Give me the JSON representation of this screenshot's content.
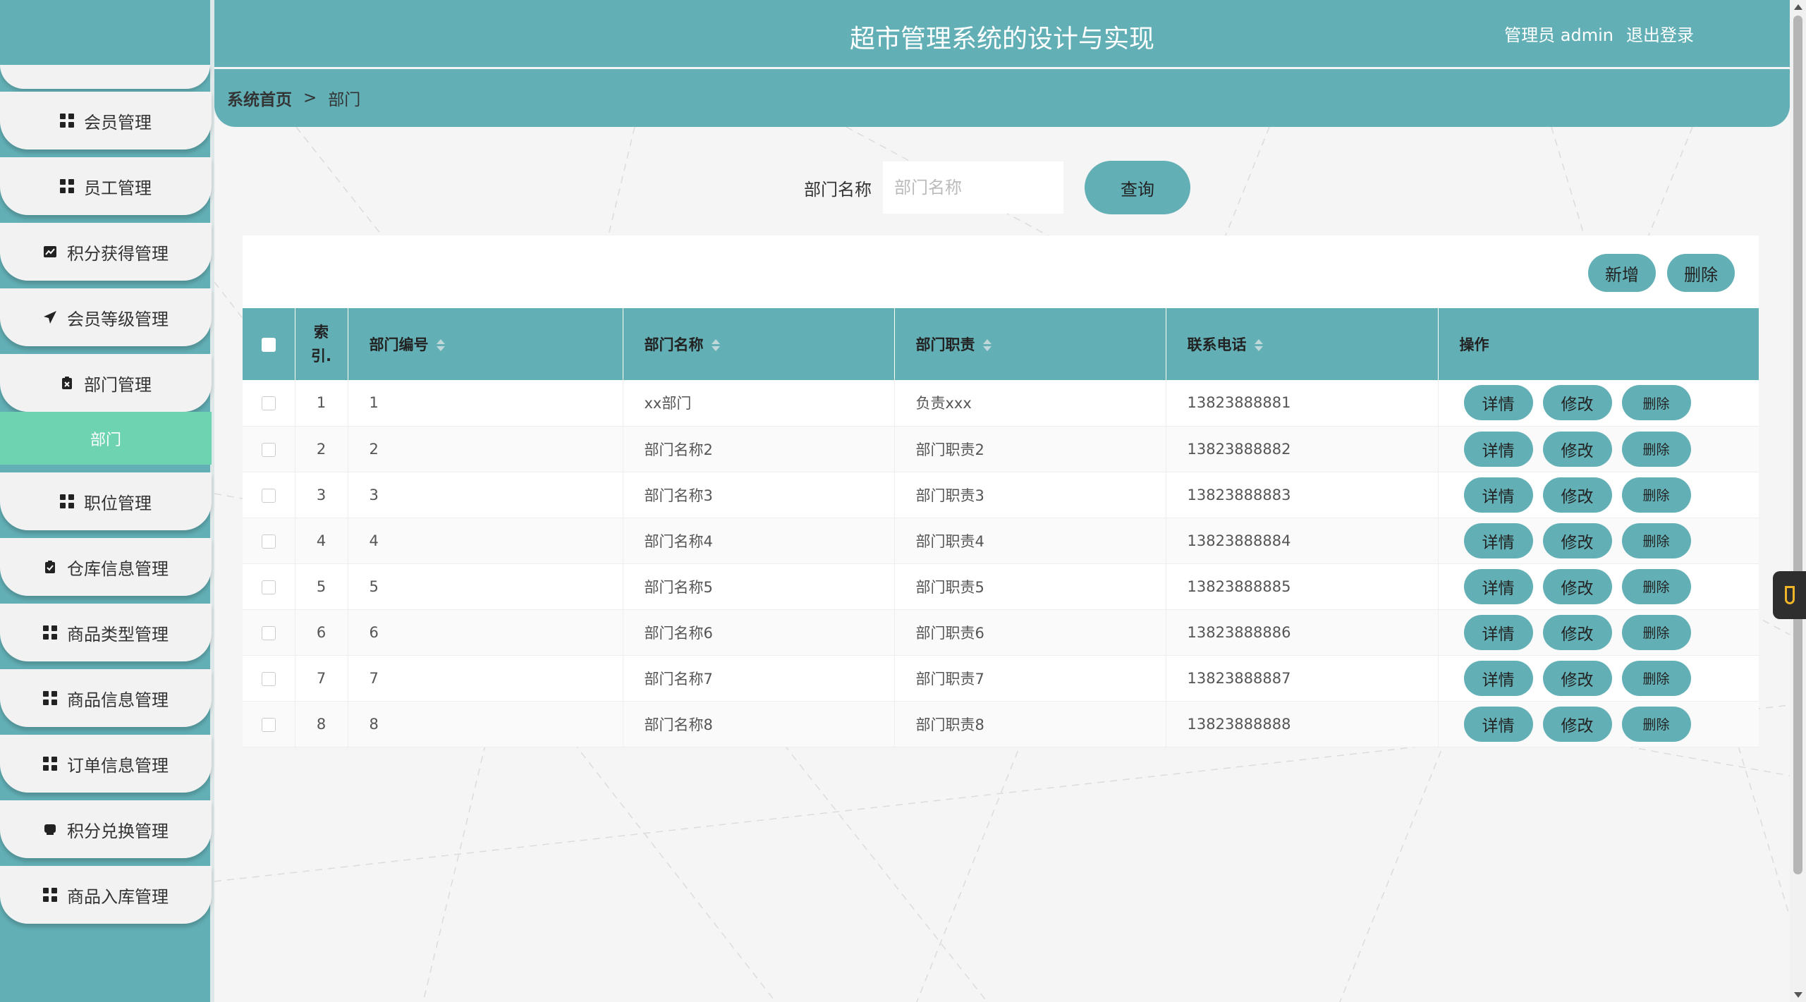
{
  "header": {
    "title": "超市管理系统的设计与实现",
    "user": "管理员 admin",
    "logout": "退出登录"
  },
  "breadcrumb": {
    "home": "系统首页",
    "separator": ">",
    "current": "部门"
  },
  "sidebar": {
    "items": [
      {
        "label": "会员管理",
        "icon": "grid-icon"
      },
      {
        "label": "员工管理",
        "icon": "grid-icon"
      },
      {
        "label": "积分获得管理",
        "icon": "chart-icon"
      },
      {
        "label": "会员等级管理",
        "icon": "send-icon"
      },
      {
        "label": "部门管理",
        "icon": "clipboard-x-icon"
      },
      {
        "label": "职位管理",
        "icon": "grid-icon"
      },
      {
        "label": "仓库信息管理",
        "icon": "clipboard-check-icon"
      },
      {
        "label": "商品类型管理",
        "icon": "grid-icon"
      },
      {
        "label": "商品信息管理",
        "icon": "grid-icon"
      },
      {
        "label": "订单信息管理",
        "icon": "grid-icon"
      },
      {
        "label": "积分兑换管理",
        "icon": "inbox-icon"
      },
      {
        "label": "商品入库管理",
        "icon": "grid-icon"
      }
    ],
    "active_sub": "部门"
  },
  "search": {
    "label": "部门名称",
    "placeholder": "部门名称",
    "value": "",
    "button": "查询"
  },
  "toolbar": {
    "add": "新增",
    "delete": "删除"
  },
  "table": {
    "headers": {
      "index": "索引.",
      "code": "部门编号",
      "name": "部门名称",
      "duty": "部门职责",
      "phone": "联系电话",
      "ops": "操作"
    },
    "actions": {
      "detail": "详情",
      "edit": "修改",
      "delete": "删除"
    },
    "rows": [
      {
        "index": "1",
        "code": "1",
        "name": "xx部门",
        "duty": "负责xxx",
        "phone": "13823888881"
      },
      {
        "index": "2",
        "code": "2",
        "name": "部门名称2",
        "duty": "部门职责2",
        "phone": "13823888882"
      },
      {
        "index": "3",
        "code": "3",
        "name": "部门名称3",
        "duty": "部门职责3",
        "phone": "13823888883"
      },
      {
        "index": "4",
        "code": "4",
        "name": "部门名称4",
        "duty": "部门职责4",
        "phone": "13823888884"
      },
      {
        "index": "5",
        "code": "5",
        "name": "部门名称5",
        "duty": "部门职责5",
        "phone": "13823888885"
      },
      {
        "index": "6",
        "code": "6",
        "name": "部门名称6",
        "duty": "部门职责6",
        "phone": "13823888886"
      },
      {
        "index": "7",
        "code": "7",
        "name": "部门名称7",
        "duty": "部门职责7",
        "phone": "13823888887"
      },
      {
        "index": "8",
        "code": "8",
        "name": "部门名称8",
        "duty": "部门职责8",
        "phone": "13823888888"
      }
    ]
  },
  "colors": {
    "primary": "#62b0b6",
    "active": "#6dd3b0",
    "background": "#f5f5f5"
  }
}
